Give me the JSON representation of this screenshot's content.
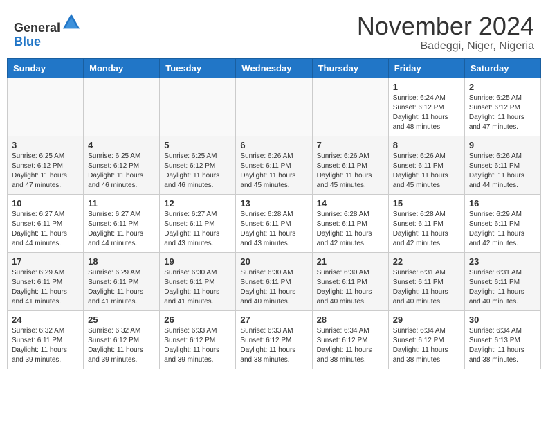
{
  "header": {
    "logo_general": "General",
    "logo_blue": "Blue",
    "month_title": "November 2024",
    "location": "Badeggi, Niger, Nigeria"
  },
  "weekdays": [
    "Sunday",
    "Monday",
    "Tuesday",
    "Wednesday",
    "Thursday",
    "Friday",
    "Saturday"
  ],
  "weeks": [
    [
      {
        "day": "",
        "info": ""
      },
      {
        "day": "",
        "info": ""
      },
      {
        "day": "",
        "info": ""
      },
      {
        "day": "",
        "info": ""
      },
      {
        "day": "",
        "info": ""
      },
      {
        "day": "1",
        "info": "Sunrise: 6:24 AM\nSunset: 6:12 PM\nDaylight: 11 hours\nand 48 minutes."
      },
      {
        "day": "2",
        "info": "Sunrise: 6:25 AM\nSunset: 6:12 PM\nDaylight: 11 hours\nand 47 minutes."
      }
    ],
    [
      {
        "day": "3",
        "info": "Sunrise: 6:25 AM\nSunset: 6:12 PM\nDaylight: 11 hours\nand 47 minutes."
      },
      {
        "day": "4",
        "info": "Sunrise: 6:25 AM\nSunset: 6:12 PM\nDaylight: 11 hours\nand 46 minutes."
      },
      {
        "day": "5",
        "info": "Sunrise: 6:25 AM\nSunset: 6:12 PM\nDaylight: 11 hours\nand 46 minutes."
      },
      {
        "day": "6",
        "info": "Sunrise: 6:26 AM\nSunset: 6:11 PM\nDaylight: 11 hours\nand 45 minutes."
      },
      {
        "day": "7",
        "info": "Sunrise: 6:26 AM\nSunset: 6:11 PM\nDaylight: 11 hours\nand 45 minutes."
      },
      {
        "day": "8",
        "info": "Sunrise: 6:26 AM\nSunset: 6:11 PM\nDaylight: 11 hours\nand 45 minutes."
      },
      {
        "day": "9",
        "info": "Sunrise: 6:26 AM\nSunset: 6:11 PM\nDaylight: 11 hours\nand 44 minutes."
      }
    ],
    [
      {
        "day": "10",
        "info": "Sunrise: 6:27 AM\nSunset: 6:11 PM\nDaylight: 11 hours\nand 44 minutes."
      },
      {
        "day": "11",
        "info": "Sunrise: 6:27 AM\nSunset: 6:11 PM\nDaylight: 11 hours\nand 44 minutes."
      },
      {
        "day": "12",
        "info": "Sunrise: 6:27 AM\nSunset: 6:11 PM\nDaylight: 11 hours\nand 43 minutes."
      },
      {
        "day": "13",
        "info": "Sunrise: 6:28 AM\nSunset: 6:11 PM\nDaylight: 11 hours\nand 43 minutes."
      },
      {
        "day": "14",
        "info": "Sunrise: 6:28 AM\nSunset: 6:11 PM\nDaylight: 11 hours\nand 42 minutes."
      },
      {
        "day": "15",
        "info": "Sunrise: 6:28 AM\nSunset: 6:11 PM\nDaylight: 11 hours\nand 42 minutes."
      },
      {
        "day": "16",
        "info": "Sunrise: 6:29 AM\nSunset: 6:11 PM\nDaylight: 11 hours\nand 42 minutes."
      }
    ],
    [
      {
        "day": "17",
        "info": "Sunrise: 6:29 AM\nSunset: 6:11 PM\nDaylight: 11 hours\nand 41 minutes."
      },
      {
        "day": "18",
        "info": "Sunrise: 6:29 AM\nSunset: 6:11 PM\nDaylight: 11 hours\nand 41 minutes."
      },
      {
        "day": "19",
        "info": "Sunrise: 6:30 AM\nSunset: 6:11 PM\nDaylight: 11 hours\nand 41 minutes."
      },
      {
        "day": "20",
        "info": "Sunrise: 6:30 AM\nSunset: 6:11 PM\nDaylight: 11 hours\nand 40 minutes."
      },
      {
        "day": "21",
        "info": "Sunrise: 6:30 AM\nSunset: 6:11 PM\nDaylight: 11 hours\nand 40 minutes."
      },
      {
        "day": "22",
        "info": "Sunrise: 6:31 AM\nSunset: 6:11 PM\nDaylight: 11 hours\nand 40 minutes."
      },
      {
        "day": "23",
        "info": "Sunrise: 6:31 AM\nSunset: 6:11 PM\nDaylight: 11 hours\nand 40 minutes."
      }
    ],
    [
      {
        "day": "24",
        "info": "Sunrise: 6:32 AM\nSunset: 6:11 PM\nDaylight: 11 hours\nand 39 minutes."
      },
      {
        "day": "25",
        "info": "Sunrise: 6:32 AM\nSunset: 6:12 PM\nDaylight: 11 hours\nand 39 minutes."
      },
      {
        "day": "26",
        "info": "Sunrise: 6:33 AM\nSunset: 6:12 PM\nDaylight: 11 hours\nand 39 minutes."
      },
      {
        "day": "27",
        "info": "Sunrise: 6:33 AM\nSunset: 6:12 PM\nDaylight: 11 hours\nand 38 minutes."
      },
      {
        "day": "28",
        "info": "Sunrise: 6:34 AM\nSunset: 6:12 PM\nDaylight: 11 hours\nand 38 minutes."
      },
      {
        "day": "29",
        "info": "Sunrise: 6:34 AM\nSunset: 6:12 PM\nDaylight: 11 hours\nand 38 minutes."
      },
      {
        "day": "30",
        "info": "Sunrise: 6:34 AM\nSunset: 6:13 PM\nDaylight: 11 hours\nand 38 minutes."
      }
    ]
  ]
}
